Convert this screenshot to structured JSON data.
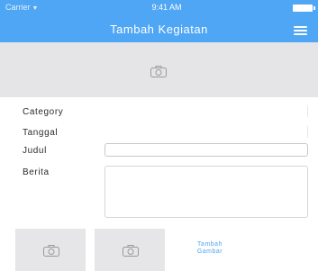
{
  "status_bar": {
    "carrier": "Carrier",
    "time": "9:41 AM"
  },
  "nav": {
    "title": "Tambah Kegiatan",
    "menu_icon": "hamburger-icon"
  },
  "header_photo": {
    "icon": "camera-icon"
  },
  "form": {
    "category_label": "Category",
    "tanggal_label": "Tanggal",
    "judul_label": "Judul",
    "berita_label": "Berita",
    "category_value": "",
    "tanggal_value": "",
    "judul_value": "",
    "berita_value": ""
  },
  "photos": {
    "slot_icon": "camera-icon",
    "add_line1": "Tambah",
    "add_line2": "Gambar"
  },
  "colors": {
    "accent": "#4ea6f4",
    "placeholder_bg": "#e5e5e7",
    "text": "#2b2b2b"
  }
}
